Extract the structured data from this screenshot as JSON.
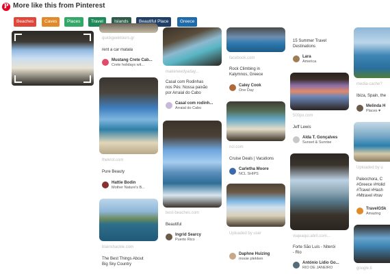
{
  "header": {
    "title": "More like this from Pinterest",
    "logo": "P"
  },
  "chips": [
    {
      "label": "Beaches",
      "color": "#e0473b"
    },
    {
      "label": "Caves",
      "color": "#e08a2a"
    },
    {
      "label": "Places",
      "color": "#33a868"
    },
    {
      "label": "Travel",
      "color": "#1e8a5a"
    },
    {
      "label": "Islands",
      "color": "#2d5c4a"
    },
    {
      "label": "Beautiful Place",
      "color": "#1f3f66"
    },
    {
      "label": "Greece",
      "color": "#1f6aa8"
    }
  ],
  "pins": {
    "c1p1": {
      "src": "quickgeektours.gr",
      "desc": "rent a car matala",
      "user": "Mustang Crete Cab...",
      "board": "Crete holidays wit..."
    },
    "c1p2": {
      "src": "thekrot.com",
      "desc": "Pure Beauty",
      "user": "Hattie Bodin",
      "board": "Mother Nature's B..."
    },
    "c1p3": {
      "src": "blainshackle.com",
      "desc1": "The Best Things About",
      "desc2": "Big Sky Country"
    },
    "c2p1": {
      "src": "makeneedyaday...",
      "desc1": "Casal com Rodinhas",
      "desc2": "nos Pés: Nossa paixão",
      "desc3": "por Arraial do Cabo",
      "user": "Casal com rodinh...",
      "board": "Arraial do Cabo"
    },
    "c2p2": {
      "src": "best-beaches.com",
      "desc": "Beautiful",
      "user": "Ingrid Searcy",
      "board": "Puerto Rico"
    },
    "c3p1": {
      "src": "facebook.com",
      "desc1": "Rock Climbing in",
      "desc2": "Kalymnos, Greece",
      "user": "Caley Cook",
      "board": "One Day"
    },
    "c3p2": {
      "src": "ncl.com",
      "desc": "Cruise Deals | Vacations",
      "user": "Carletha Moore",
      "board": "NCL SHIPS"
    },
    "c3p3": {
      "src": "Uploaded by user",
      "user": "Daphne Huizing",
      "board": "mooie plekken"
    },
    "c4p1": {
      "desc1": "15 Summer Travel",
      "desc2": "Destinations",
      "user": "Lara",
      "board": "America"
    },
    "c4p2": {
      "src": "500px.com",
      "desc": "Jeff Lewis",
      "user": "Alda T. Gonçalves",
      "board": "Sunset & Sunrise"
    },
    "c4p3": {
      "src": "viajeaqui.abril.com...",
      "desc1": "Forte São Luís - Niterói",
      "desc2": "- Rio",
      "user": "António Lídio Go...",
      "board": "RIO DE JANEIRO"
    },
    "c5p1": {
      "src": "media-cache?",
      "desc": "Ibiza, Spain, the",
      "user": "Melinda H",
      "board": "Places ♥"
    },
    "c5p2": {
      "src": "Uploaded by u",
      "desc1": "Paleochora, C",
      "desc2": "#Greece #Holid",
      "desc3": "#Travel #Hash",
      "desc4": "#Mtravel #trav",
      "user": "TravelGSk",
      "board": "Amazing"
    },
    "c5p3": {
      "src": "google.ti"
    }
  }
}
